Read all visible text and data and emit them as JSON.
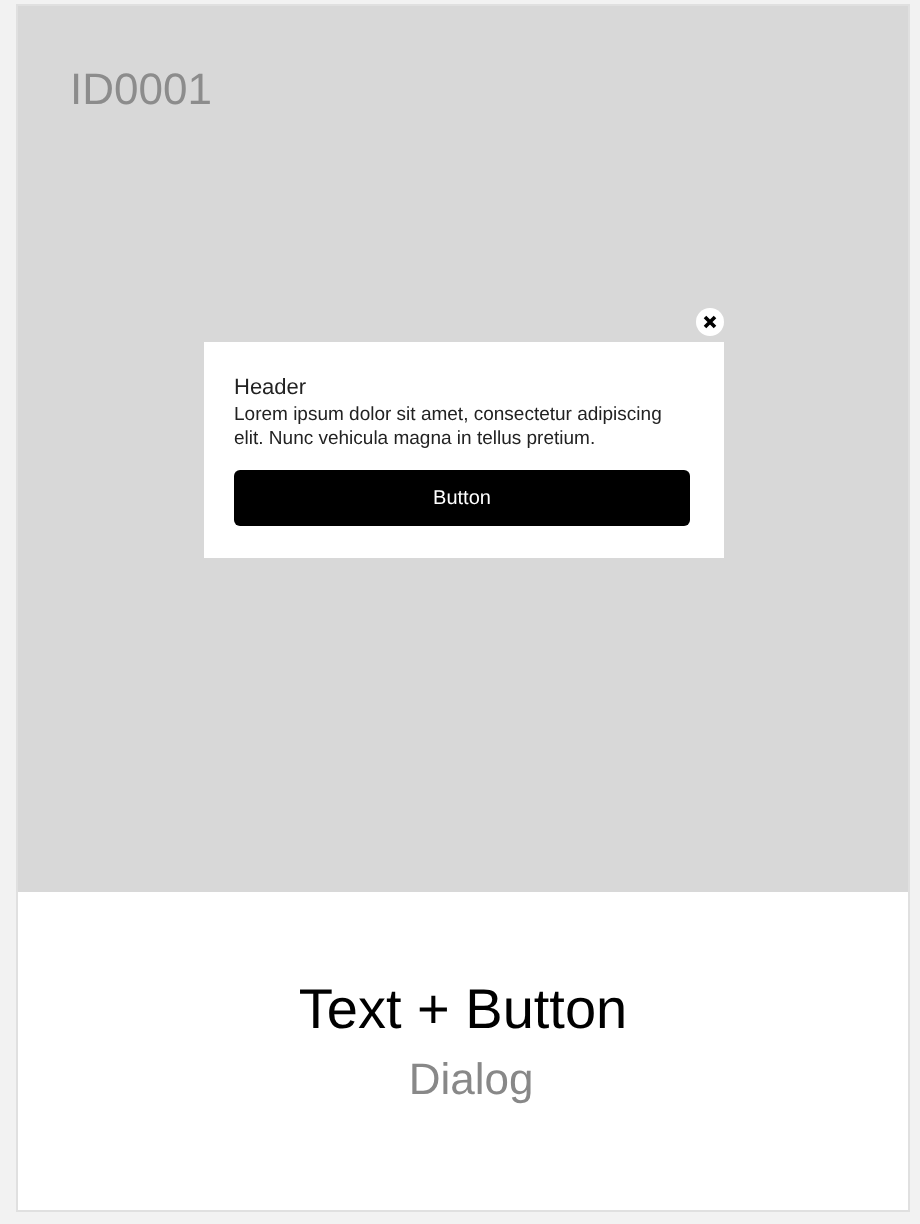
{
  "preview": {
    "id_label": "ID0001",
    "dialog": {
      "header": "Header",
      "body": "Lorem ipsum dolor sit amet, consectetur adipiscing elit. Nunc vehicula magna in tellus pretium.",
      "button": "Button",
      "closable": true
    }
  },
  "caption": {
    "title": "Text + Button",
    "subtitle": "Dialog"
  }
}
